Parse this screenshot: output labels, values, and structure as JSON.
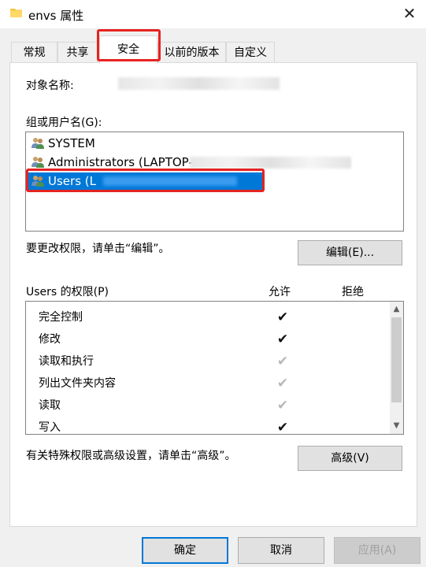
{
  "window": {
    "title": "envs 属性",
    "close_glyph": "✕"
  },
  "tabs": [
    {
      "label": "常规"
    },
    {
      "label": "共享"
    },
    {
      "label": "安全",
      "active": true
    },
    {
      "label": "以前的版本"
    },
    {
      "label": "自定义"
    }
  ],
  "security": {
    "object_name_label": "对象名称:",
    "groups_label": "组或用户名(G):",
    "groups": [
      {
        "name": "SYSTEM"
      },
      {
        "name": "Administrators (LAPTOP-"
      },
      {
        "name": "Users (L",
        "selected": true
      }
    ],
    "change_hint": "要更改权限，请单击“编辑”。",
    "edit_button": "编辑(E)...",
    "permissions_label": "Users 的权限(P)",
    "allow_header": "允许",
    "deny_header": "拒绝",
    "permissions": [
      {
        "name": "完全控制",
        "allow": true,
        "inherited": false
      },
      {
        "name": "修改",
        "allow": true,
        "inherited": false
      },
      {
        "name": "读取和执行",
        "allow": true,
        "inherited": true
      },
      {
        "name": "列出文件夹内容",
        "allow": true,
        "inherited": true
      },
      {
        "name": "读取",
        "allow": true,
        "inherited": true
      },
      {
        "name": "写入",
        "allow": true,
        "inherited": false
      }
    ],
    "advanced_hint": "有关特殊权限或高级设置，请单击“高级”。",
    "advanced_button": "高级(V)"
  },
  "footer": {
    "ok_button": "确定",
    "cancel_button": "取消",
    "apply_button": "应用(A)"
  },
  "colors": {
    "highlight": "#e52321",
    "selection": "#0078d7"
  },
  "icons": {
    "window": "folder-icon",
    "group": "users-group-icon",
    "check": "checkmark-icon"
  }
}
